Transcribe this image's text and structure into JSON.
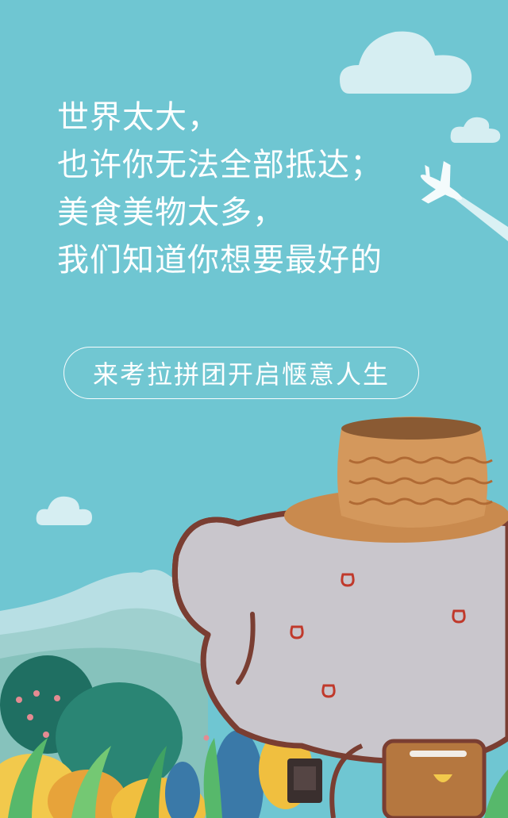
{
  "slogan": {
    "line1": "世界太大，",
    "line2": "也许你无法全部抵达；",
    "line3": "美食美物太多，",
    "line4": "我们知道你想要最好的"
  },
  "cta": {
    "label": "来考拉拼团开启惬意人生"
  },
  "colors": {
    "sky": "#6fc6d2",
    "cloud": "#d6eef2",
    "mountain": "#a9d7de",
    "elephant": "#c8c6cc",
    "outline": "#7a3e32",
    "hat": "#d4985c",
    "bag": "#b5773f"
  },
  "icons": [
    "cloud-icon",
    "airplane-icon",
    "elephant-mascot",
    "straw-hat-icon",
    "camera-icon",
    "satchel-icon"
  ]
}
